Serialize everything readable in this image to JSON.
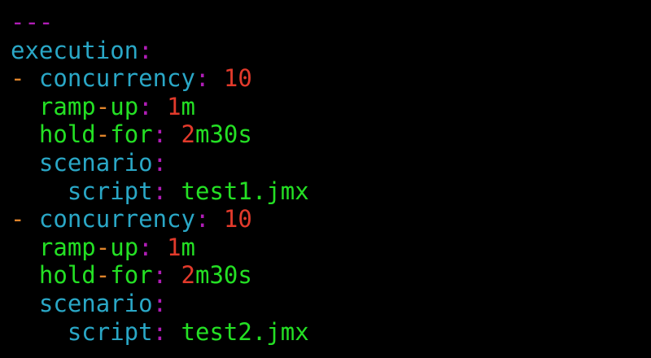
{
  "colors": {
    "background": "#000000",
    "cyan": "#2aa7c6",
    "green": "#24e024",
    "magenta": "#b01db6",
    "orange": "#e0842a",
    "red": "#e23a2b"
  },
  "lines": [
    {
      "segments": [
        {
          "text": "---",
          "color": "magenta"
        }
      ]
    },
    {
      "segments": [
        {
          "text": "execution",
          "color": "cyan"
        },
        {
          "text": ":",
          "color": "magenta"
        }
      ]
    },
    {
      "segments": [
        {
          "text": "- ",
          "color": "orange"
        },
        {
          "text": "concurrency",
          "color": "cyan"
        },
        {
          "text": ": ",
          "color": "magenta"
        },
        {
          "text": "10",
          "color": "red"
        }
      ]
    },
    {
      "segments": [
        {
          "text": "  ",
          "color": "cyan"
        },
        {
          "text": "ramp",
          "color": "green"
        },
        {
          "text": "-",
          "color": "orange"
        },
        {
          "text": "up",
          "color": "green"
        },
        {
          "text": ": ",
          "color": "magenta"
        },
        {
          "text": "1",
          "color": "red"
        },
        {
          "text": "m",
          "color": "green"
        }
      ]
    },
    {
      "segments": [
        {
          "text": "  ",
          "color": "cyan"
        },
        {
          "text": "hold",
          "color": "green"
        },
        {
          "text": "-",
          "color": "orange"
        },
        {
          "text": "for",
          "color": "green"
        },
        {
          "text": ": ",
          "color": "magenta"
        },
        {
          "text": "2",
          "color": "red"
        },
        {
          "text": "m30s",
          "color": "green"
        }
      ]
    },
    {
      "segments": [
        {
          "text": "  ",
          "color": "cyan"
        },
        {
          "text": "scenario",
          "color": "cyan"
        },
        {
          "text": ":",
          "color": "magenta"
        }
      ]
    },
    {
      "segments": [
        {
          "text": "    ",
          "color": "cyan"
        },
        {
          "text": "script",
          "color": "cyan"
        },
        {
          "text": ": ",
          "color": "magenta"
        },
        {
          "text": "test1.jmx",
          "color": "green"
        }
      ]
    },
    {
      "segments": [
        {
          "text": "- ",
          "color": "orange"
        },
        {
          "text": "concurrency",
          "color": "cyan"
        },
        {
          "text": ": ",
          "color": "magenta"
        },
        {
          "text": "10",
          "color": "red"
        }
      ]
    },
    {
      "segments": [
        {
          "text": "  ",
          "color": "cyan"
        },
        {
          "text": "ramp",
          "color": "green"
        },
        {
          "text": "-",
          "color": "orange"
        },
        {
          "text": "up",
          "color": "green"
        },
        {
          "text": ": ",
          "color": "magenta"
        },
        {
          "text": "1",
          "color": "red"
        },
        {
          "text": "m",
          "color": "green"
        }
      ]
    },
    {
      "segments": [
        {
          "text": "  ",
          "color": "cyan"
        },
        {
          "text": "hold",
          "color": "green"
        },
        {
          "text": "-",
          "color": "orange"
        },
        {
          "text": "for",
          "color": "green"
        },
        {
          "text": ": ",
          "color": "magenta"
        },
        {
          "text": "2",
          "color": "red"
        },
        {
          "text": "m30s",
          "color": "green"
        }
      ]
    },
    {
      "segments": [
        {
          "text": "  ",
          "color": "cyan"
        },
        {
          "text": "scenario",
          "color": "cyan"
        },
        {
          "text": ":",
          "color": "magenta"
        }
      ]
    },
    {
      "segments": [
        {
          "text": "    ",
          "color": "cyan"
        },
        {
          "text": "script",
          "color": "cyan"
        },
        {
          "text": ": ",
          "color": "magenta"
        },
        {
          "text": "test2.jmx",
          "color": "green"
        }
      ]
    }
  ]
}
